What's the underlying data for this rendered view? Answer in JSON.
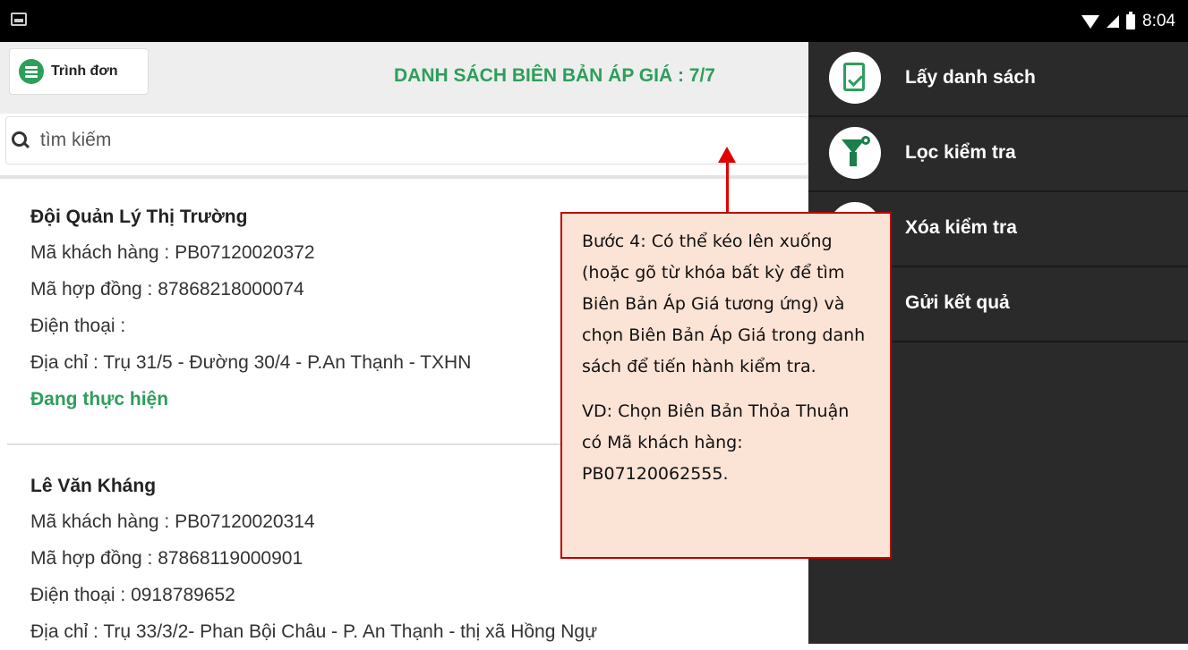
{
  "status_bar": {
    "time": "8:04"
  },
  "header": {
    "menu_label": "Trình đơn",
    "title": "DANH SÁCH BIÊN BẢN ÁP GIÁ : 7/7"
  },
  "search": {
    "placeholder": "tìm kiếm"
  },
  "records": [
    {
      "name": "Đội Quản Lý Thị Trường",
      "customer_code": "Mã khách hàng : PB07120020372",
      "contract": "Mã hợp đồng : 87868218000074",
      "phone": "Điện thoại :",
      "address": "Địa chỉ : Trụ 31/5 - Đường 30/4 - P.An Thạnh - TXHN",
      "status": "Đang thực hiện"
    },
    {
      "name": "Lê Văn Kháng",
      "customer_code": "Mã khách hàng : PB07120020314",
      "contract": "Mã hợp đồng : 87868119000901",
      "phone": "Điện thoại : 0918789652",
      "address": "Địa chỉ : Trụ 33/3/2- Phan Bội Châu - P. An Thạnh - thị xã Hồng Ngự"
    }
  ],
  "drawer": {
    "items": [
      {
        "label": "Lấy danh sách",
        "icon": "document-check-icon"
      },
      {
        "label": "Lọc kiểm tra",
        "icon": "filter-icon"
      },
      {
        "label": "Xóa kiểm tra",
        "icon": "document-delete-icon"
      },
      {
        "label": "Gửi kết quả",
        "icon": "send-icon"
      }
    ]
  },
  "callout": {
    "text1": "Bước 4: Có thể kéo lên xuống (hoặc gõ từ khóa bất kỳ để tìm Biên Bản Áp Giá tương ứng) và chọn Biên Bản Áp Giá trong danh sách để tiến hành kiểm tra.",
    "text2": "VD: Chọn Biên Bản Thỏa Thuận có Mã khách hàng: PB07120062555."
  },
  "colors": {
    "accent": "#2e9e5b",
    "drawer_bg": "#2a2a2a",
    "callout_bg": "#fbe3d6",
    "callout_border": "#c00000"
  }
}
